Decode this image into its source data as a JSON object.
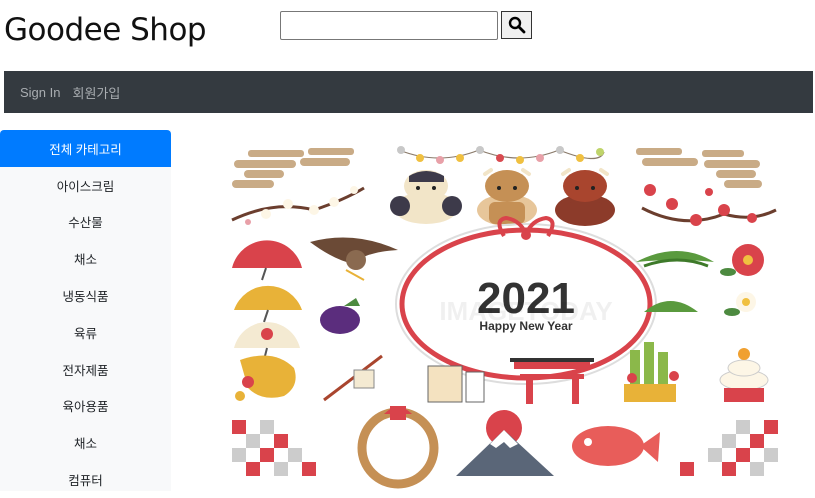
{
  "header": {
    "brand": "Goodee Shop",
    "search": {
      "value": "",
      "placeholder": "",
      "button_icon": "search-icon"
    }
  },
  "nav": {
    "items": [
      "Sign In",
      "회원가입"
    ]
  },
  "sidebar": {
    "items": [
      "전체 카테고리",
      "아이스크림",
      "수산물",
      "채소",
      "냉동식품",
      "육류",
      "전자제품",
      "육아용품",
      "채소",
      "컴퓨터"
    ],
    "active_index": 0,
    "active_color": "#007bff"
  },
  "banner": {
    "year": "2021",
    "greeting": "Happy New Year",
    "watermark": "IMAGETODAY"
  },
  "colors": {
    "navbar": "#343a40",
    "accent": "#007bff",
    "sidebar_bg": "#f8f9fa",
    "banner_red": "#d9434b"
  }
}
